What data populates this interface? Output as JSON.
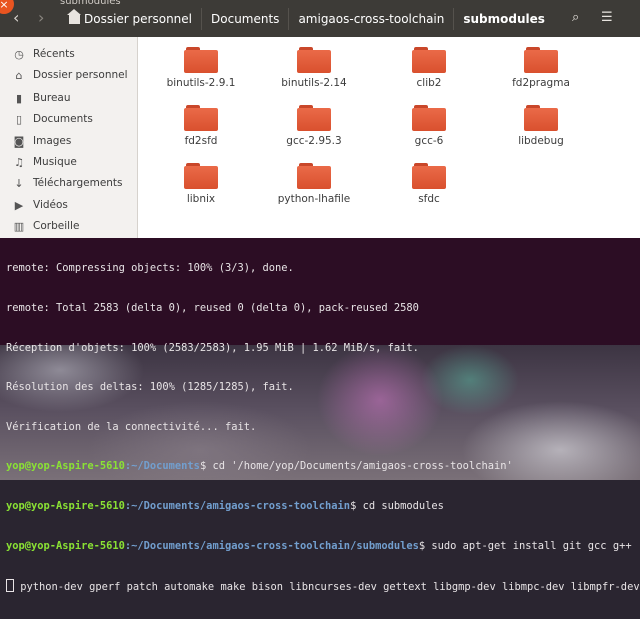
{
  "window": {
    "title": "submodules",
    "close_label": "×"
  },
  "header": {
    "back_icon": "‹",
    "forward_icon": "›",
    "breadcrumbs": [
      {
        "label": "Dossier personnel",
        "icon": "home-icon"
      },
      {
        "label": "Documents"
      },
      {
        "label": "amigaos-cross-toolchain"
      },
      {
        "label": "submodules",
        "active": true
      }
    ],
    "search_icon": "⌕",
    "list_icon": "☰"
  },
  "sidebar": {
    "items": [
      {
        "label": "Récents",
        "icon": "clock-icon",
        "glyph": "◷"
      },
      {
        "label": "Dossier personnel",
        "icon": "home-icon",
        "glyph": "⌂"
      },
      {
        "label": "Bureau",
        "icon": "desktop-icon",
        "glyph": "▮"
      },
      {
        "label": "Documents",
        "icon": "document-icon",
        "glyph": "▯"
      },
      {
        "label": "Images",
        "icon": "camera-icon",
        "glyph": "◙"
      },
      {
        "label": "Musique",
        "icon": "music-icon",
        "glyph": "♫"
      },
      {
        "label": "Téléchargements",
        "icon": "download-icon",
        "glyph": "↓"
      },
      {
        "label": "Vidéos",
        "icon": "video-icon",
        "glyph": "▶"
      },
      {
        "label": "Corbeille",
        "icon": "trash-icon",
        "glyph": "▥"
      }
    ]
  },
  "folders": [
    {
      "label": "binutils-2.9.1"
    },
    {
      "label": "binutils-2.14"
    },
    {
      "label": "clib2"
    },
    {
      "label": "fd2pragma"
    },
    {
      "label": "fd2sfd"
    },
    {
      "label": "gcc-2.95.3"
    },
    {
      "label": "gcc-6"
    },
    {
      "label": "libdebug"
    },
    {
      "label": "libnix"
    },
    {
      "label": "python-lhafile"
    },
    {
      "label": "sfdc"
    }
  ],
  "terminal": {
    "lines": [
      "remote: Compressing objects: 100% (3/3), done.",
      "remote: Total 2583 (delta 0), reused 0 (delta 0), pack-reused 2580",
      "Réception d'objets: 100% (2583/2583), 1.95 MiB | 1.62 MiB/s, fait.",
      "Résolution des deltas: 100% (1285/1285), fait.",
      "Vérification de la connectivité... fait."
    ],
    "prompts": [
      {
        "user": "yop@yop-Aspire-5610",
        "path": ":~/Documents",
        "cmd": "$ cd '/home/yop/Documents/amigaos-cross-toolchain'"
      },
      {
        "user": "yop@yop-Aspire-5610",
        "path": ":~/Documents/amigaos-cross-toolchain",
        "cmd": "$ cd submodules"
      },
      {
        "user": "yop@yop-Aspire-5610",
        "path": ":~/Documents/amigaos-cross-toolchain/submodules",
        "cmd": "$ sudo apt-get install git gcc g++"
      }
    ],
    "continuation": "python-dev gperf patch automake make bison libncurses-dev gettext libgmp-dev libmpc-dev libmpfr-dev",
    "colors": {
      "user": "#8ae234",
      "path": "#729fcf",
      "background": "#2c0d24"
    }
  }
}
